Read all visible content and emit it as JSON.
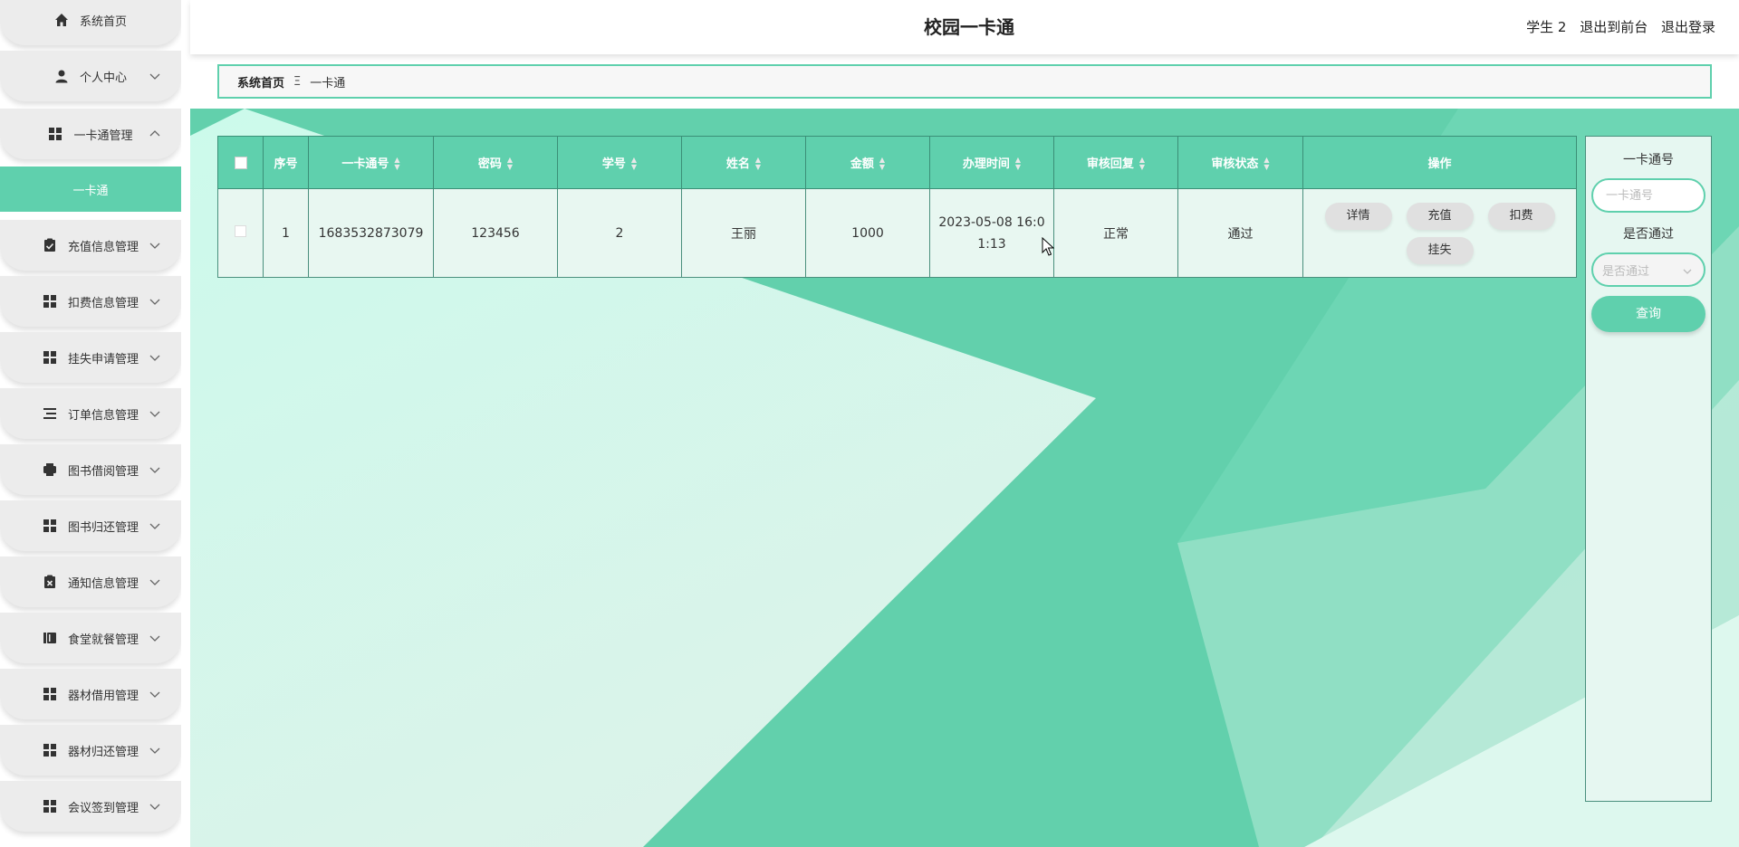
{
  "header": {
    "title": "校园一卡通",
    "user": "学生 2",
    "to_front": "退出到前台",
    "logout": "退出登录"
  },
  "sidebar": {
    "items": [
      {
        "label": "系统首页",
        "icon": "home-icon"
      },
      {
        "label": "个人中心",
        "icon": "person-icon"
      },
      {
        "label": "一卡通管理",
        "icon": "grid-icon"
      },
      {
        "label": "充值信息管理",
        "icon": "clipboard-check-icon"
      },
      {
        "label": "扣费信息管理",
        "icon": "grid-icon"
      },
      {
        "label": "挂失申请管理",
        "icon": "grid-icon"
      },
      {
        "label": "订单信息管理",
        "icon": "list-icon"
      },
      {
        "label": "图书借阅管理",
        "icon": "printer-icon"
      },
      {
        "label": "图书归还管理",
        "icon": "grid-icon"
      },
      {
        "label": "通知信息管理",
        "icon": "clipboard-x-icon"
      },
      {
        "label": "食堂就餐管理",
        "icon": "book-icon"
      },
      {
        "label": "器材借用管理",
        "icon": "grid-icon"
      },
      {
        "label": "器材归还管理",
        "icon": "grid-icon"
      },
      {
        "label": "会议签到管理",
        "icon": "grid-icon"
      }
    ],
    "active_submenu": "一卡通"
  },
  "breadcrumb": {
    "home": "系统首页",
    "separator": "Ξ",
    "current": "一卡通"
  },
  "table": {
    "columns": [
      "序号",
      "一卡通号",
      "密码",
      "学号",
      "姓名",
      "金额",
      "办理时间",
      "审核回复",
      "审核状态",
      "操作"
    ],
    "rows": [
      {
        "index": "1",
        "card_no": "1683532873079",
        "password": "123456",
        "student_no": "2",
        "name": "王丽",
        "amount": "1000",
        "time_line1": "2023-05-08 16:0",
        "time_line2": "1:13",
        "reply": "正常",
        "status": "通过"
      }
    ],
    "actions": [
      "详情",
      "充值",
      "扣费",
      "挂失"
    ]
  },
  "search": {
    "card_label": "一卡通号",
    "card_placeholder": "一卡通号",
    "pass_label": "是否通过",
    "pass_placeholder": "是否通过",
    "button": "查询"
  },
  "colors": {
    "accent": "#5fd0ad",
    "content_bg": "#d3f6ea"
  }
}
